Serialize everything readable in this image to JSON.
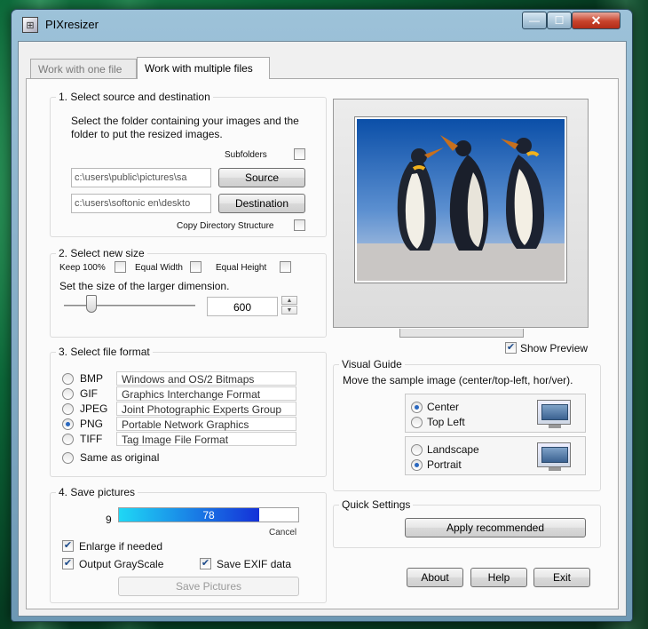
{
  "window": {
    "title": "PIXresizer",
    "minimize": "—",
    "maximize": "☐",
    "close": "✕"
  },
  "tabs": [
    {
      "label": "Work with one file"
    },
    {
      "label": "Work with multiple files"
    }
  ],
  "source": {
    "group_label": "1. Select source and destination",
    "description": "Select the folder containing your images and the folder to put the resized images.",
    "subfolders_label": "Subfolders",
    "source_path": "c:\\users\\public\\pictures\\sa",
    "source_button": "Source",
    "dest_path": "c:\\users\\softonic en\\deskto",
    "dest_button": "Destination",
    "copy_structure_label": "Copy Directory Structure"
  },
  "size": {
    "group_label": "2. Select new size",
    "keep_label": "Keep 100%",
    "equal_width_label": "Equal Width",
    "equal_height_label": "Equal Height",
    "instruction": "Set the size of the larger dimension.",
    "value": "600"
  },
  "format": {
    "group_label": "3. Select file format",
    "options": [
      {
        "name": "BMP",
        "desc": "Windows and OS/2 Bitmaps"
      },
      {
        "name": "GIF",
        "desc": "Graphics Interchange Format"
      },
      {
        "name": "JPEG",
        "desc": "Joint Photographic Experts Group"
      },
      {
        "name": "PNG",
        "desc": "Portable Network Graphics"
      },
      {
        "name": "TIFF",
        "desc": "Tag Image File Format"
      }
    ],
    "selected": "PNG",
    "same_as_original": "Same as original"
  },
  "save": {
    "group_label": "4. Save pictures",
    "count": "9",
    "progress_text": "78",
    "progress_fraction": 0.78,
    "cancel_label": "Cancel",
    "enlarge_label": "Enlarge if needed",
    "grayscale_label": "Output GrayScale",
    "exif_label": "Save EXIF data",
    "save_button": "Save Pictures"
  },
  "preview": {
    "show_preview_label": "Show Preview"
  },
  "visual_guide": {
    "group_label": "Visual Guide",
    "instruction": "Move the sample image (center/top-left, hor/ver).",
    "center_label": "Center",
    "topleft_label": "Top Left",
    "landscape_label": "Landscape",
    "portrait_label": "Portrait"
  },
  "quick": {
    "group_label": "Quick Settings",
    "apply_button": "Apply recommended"
  },
  "buttons": {
    "about": "About",
    "help": "Help",
    "exit": "Exit"
  },
  "colors": {
    "progress_start": "#1fd8f5",
    "progress_end": "#1430d8",
    "accent": "#2a68c0"
  }
}
